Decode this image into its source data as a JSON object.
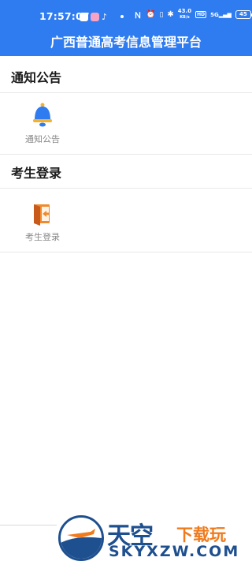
{
  "status_bar": {
    "time": "17:57:07",
    "network_speed": "43.0",
    "network_unit": "KB/s",
    "hd": "HD",
    "signal": "5G",
    "battery": "45"
  },
  "header": {
    "title": "广西普通高考信息管理平台"
  },
  "sections": [
    {
      "heading": "通知公告",
      "tile_label": "通知公告",
      "icon": "bell-icon"
    },
    {
      "heading": "考生登录",
      "tile_label": "考生登录",
      "icon": "login-door-icon"
    }
  ],
  "watermark": {
    "brand_main": "天空",
    "brand_sub": "下载玩",
    "url_text": "SKYXZW.COM"
  },
  "colors": {
    "header_bg": "#2f7cf0",
    "bell_blue": "#2f7cf0",
    "bell_gold": "#f3b12c",
    "door_orange": "#f08a2e"
  }
}
